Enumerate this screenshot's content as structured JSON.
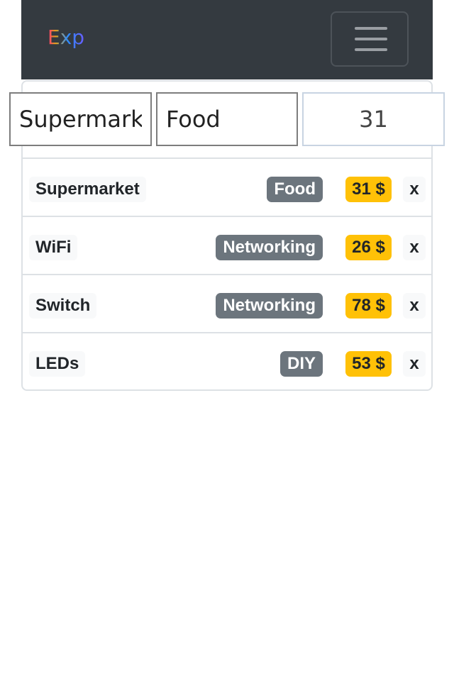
{
  "navbar": {
    "brand": "Exp",
    "menu_icon": "hamburger-menu-icon"
  },
  "form": {
    "name_value": "Supermarket",
    "category_value": "Food",
    "amount_value": "31"
  },
  "expenses": [
    {
      "name": "Supermarket",
      "category": "Food",
      "price": "31 $",
      "delete_label": "x"
    },
    {
      "name": "WiFi",
      "category": "Networking",
      "price": "26 $",
      "delete_label": "x"
    },
    {
      "name": "Switch",
      "category": "Networking",
      "price": "78 $",
      "delete_label": "x"
    },
    {
      "name": "LEDs",
      "category": "DIY",
      "price": "53 $",
      "delete_label": "x"
    }
  ],
  "colors": {
    "navbar_bg": "#343a40",
    "category_badge": "#6c757d",
    "price_badge": "#ffc107"
  }
}
